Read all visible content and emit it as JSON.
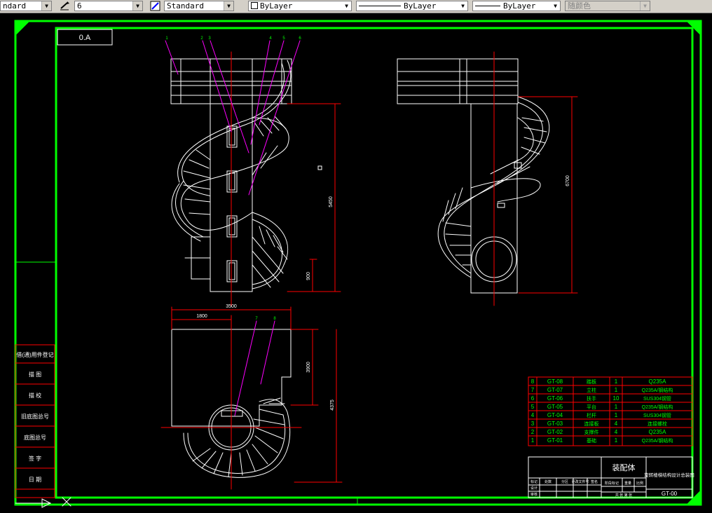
{
  "toolbar": {
    "text_style": "ndard",
    "dim_scale": "6",
    "dim_style": "Standard",
    "layer_color": "ByLayer",
    "linetype": "ByLayer",
    "lineweight": "ByLayer",
    "plot_style": "随颜色"
  },
  "drawing": {
    "corner_label": "0.A",
    "dims": {
      "front_height": "5450",
      "front_base": "900",
      "side_height": "6700",
      "plan_width": "3500",
      "plan_offset": "1800",
      "plan_depth1": "3900",
      "plan_depth2": "4375"
    },
    "balloons_front": [
      "1",
      "2",
      "3",
      "4",
      "5",
      "6"
    ],
    "balloons_plan": [
      "7",
      "8"
    ]
  },
  "side_title_block": [
    "借(通)用件登记",
    "描 图",
    "描 校",
    "旧底图总号",
    "底图总号",
    "签 字",
    "日 期"
  ],
  "bom": {
    "rows": [
      {
        "no": "8",
        "code": "GT-08",
        "name": "踏板",
        "qty": "1",
        "material": "Q235A"
      },
      {
        "no": "7",
        "code": "GT-07",
        "name": "立柱",
        "qty": "1",
        "material": "Q235A/钢结构"
      },
      {
        "no": "6",
        "code": "GT-06",
        "name": "扶手",
        "qty": "10",
        "material": "SUS304钢管"
      },
      {
        "no": "5",
        "code": "GT-05",
        "name": "平台",
        "qty": "1",
        "material": "Q235A/钢结构"
      },
      {
        "no": "4",
        "code": "GT-04",
        "name": "栏杆",
        "qty": "1",
        "material": "SUS304钢管"
      },
      {
        "no": "3",
        "code": "GT-03",
        "name": "连接板",
        "qty": "4",
        "material": "连接螺栓"
      },
      {
        "no": "2",
        "code": "GT-02",
        "name": "支撑件",
        "qty": "4",
        "material": "Q235A"
      },
      {
        "no": "1",
        "code": "GT-01",
        "name": "基础",
        "qty": "1",
        "material": "Q235A/钢结构"
      }
    ]
  },
  "title_block": {
    "assembly": "装配体",
    "drawing_title": "旋转楼梯结构设计总装图",
    "drawing_no": "GT-00",
    "cells": [
      "标记",
      "处数",
      "分区",
      "更改文件号",
      "签名",
      "日期",
      "设计",
      "审核",
      "工艺",
      "批准",
      "阶段标记",
      "重量",
      "比例",
      "共 张 第 张"
    ]
  },
  "colors": {
    "border": "#00ff00",
    "lines": "#ffffff",
    "centerline": "#ff0000",
    "leader": "#ff00ff",
    "bom_text": "#00ff00",
    "bom_grid": "#ff0000"
  }
}
